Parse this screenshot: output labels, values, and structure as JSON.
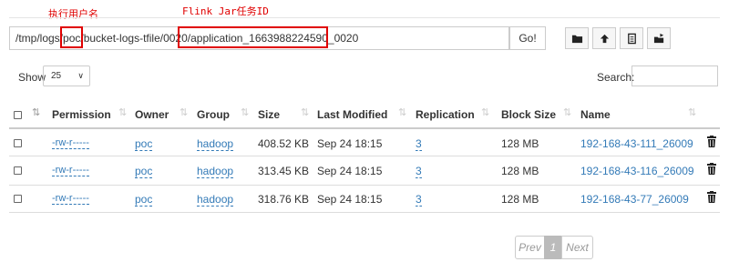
{
  "annotations": {
    "username_label": "执行用户名",
    "flink_label": "Flink Jar任务ID"
  },
  "path_bar": {
    "value": "/tmp/logs/poc/bucket-logs-tfile/0020/application_1663988224590_0020",
    "go_label": "Go!"
  },
  "toolbar_icons": [
    "folder-icon",
    "upload-icon",
    "file-icon",
    "move-folder-icon"
  ],
  "show": {
    "label": "Show",
    "selected": "25"
  },
  "search": {
    "label": "Search:",
    "value": ""
  },
  "table": {
    "columns": [
      "Permission",
      "Owner",
      "Group",
      "Size",
      "Last Modified",
      "Replication",
      "Block Size",
      "Name"
    ],
    "rows": [
      {
        "permission": "-rw-r-----",
        "owner": "poc",
        "group": "hadoop",
        "size": "408.52 KB",
        "modified": "Sep 24 18:15",
        "replication": "3",
        "block_size": "128 MB",
        "name": "192-168-43-111_26009"
      },
      {
        "permission": "-rw-r-----",
        "owner": "poc",
        "group": "hadoop",
        "size": "313.45 KB",
        "modified": "Sep 24 18:15",
        "replication": "3",
        "block_size": "128 MB",
        "name": "192-168-43-116_26009"
      },
      {
        "permission": "-rw-r-----",
        "owner": "poc",
        "group": "hadoop",
        "size": "318.76 KB",
        "modified": "Sep 24 18:15",
        "replication": "3",
        "block_size": "128 MB",
        "name": "192-168-43-77_26009"
      }
    ]
  },
  "pagination": {
    "prev": "Prev",
    "current": "1",
    "next": "Next"
  }
}
